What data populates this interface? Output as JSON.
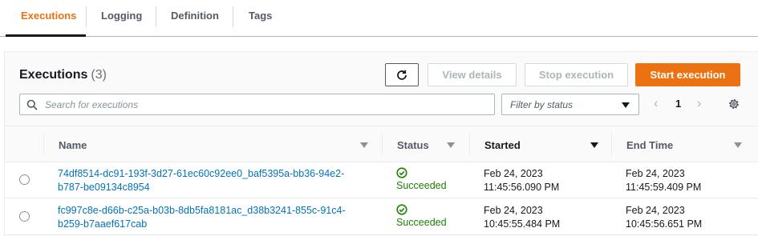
{
  "tabs": [
    {
      "label": "Executions",
      "active": true
    },
    {
      "label": "Logging",
      "active": false
    },
    {
      "label": "Definition",
      "active": false
    },
    {
      "label": "Tags",
      "active": false
    }
  ],
  "header": {
    "title": "Executions",
    "count": "(3)"
  },
  "toolbar": {
    "refresh_icon": "refresh-icon",
    "view_details_label": "View details",
    "stop_execution_label": "Stop execution",
    "start_execution_label": "Start execution"
  },
  "search": {
    "placeholder": "Search for executions",
    "icon": "search-icon"
  },
  "filter": {
    "placeholder": "Filter by status"
  },
  "pagination": {
    "current_page": "1",
    "prev": "‹",
    "next": "›"
  },
  "columns": {
    "name": "Name",
    "status": "Status",
    "started": "Started",
    "end_time": "End Time"
  },
  "rows": [
    {
      "name_line1": "74df8514-dc91-193f-3d27-61ec60c92ee0_baf5395a-bb36-94e2-",
      "name_line2": "b787-be09134c8954",
      "status": "Succeeded",
      "started_date": "Feb 24, 2023",
      "started_time": "11:45:56.090 PM",
      "end_date": "Feb 24, 2023",
      "end_time": "11:45:59.409 PM"
    },
    {
      "name_line1": "fc997c8e-d66b-c25a-b03b-8db5fa8181ac_d38b3241-855c-91c4-",
      "name_line2": "b259-b7aaef617cab",
      "status": "Succeeded",
      "started_date": "Feb 24, 2023",
      "started_time": "10:45:55.484 PM",
      "end_date": "Feb 24, 2023",
      "end_time": "10:45:56.651 PM"
    }
  ],
  "colors": {
    "accent": "#ec7211",
    "link": "#0073bb",
    "success": "#1d8102"
  }
}
